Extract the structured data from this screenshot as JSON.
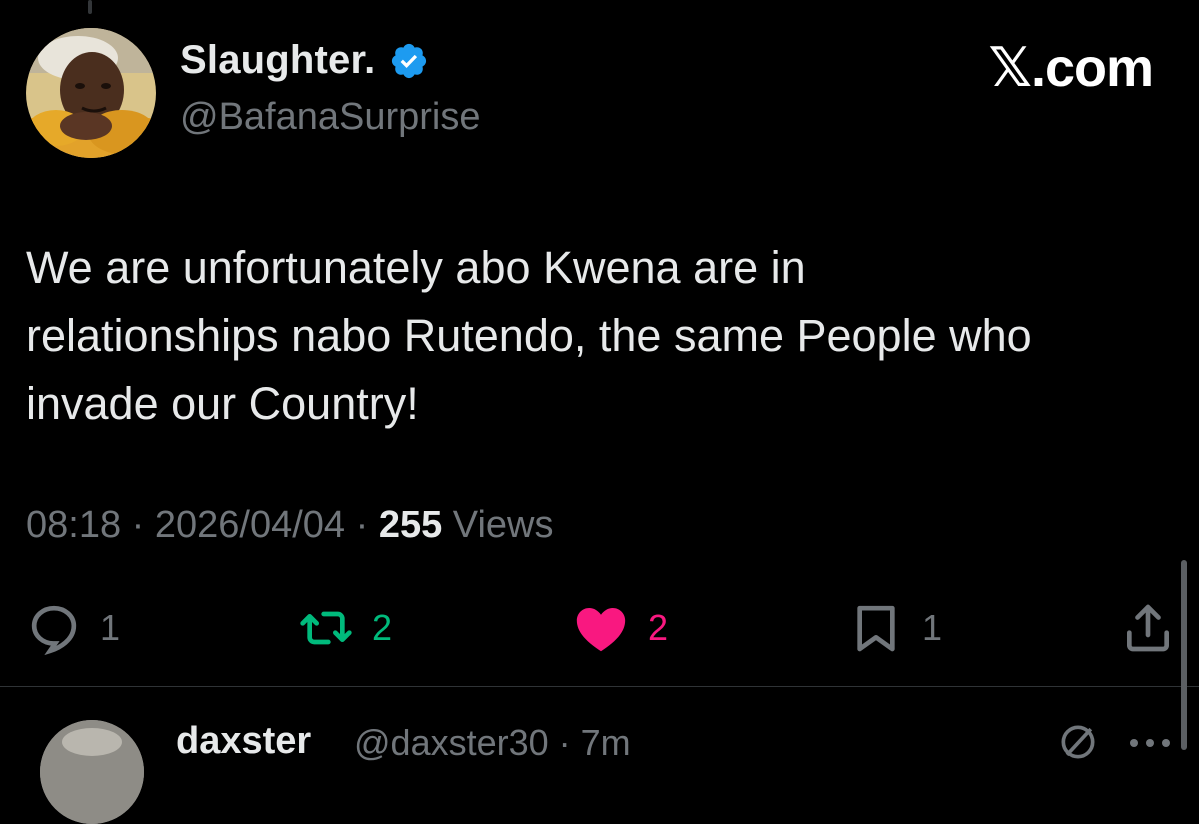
{
  "tweet": {
    "author": {
      "display_name": "Slaughter.",
      "handle": "@BafanaSurprise",
      "verified": true,
      "avatar_icon": "profile-photo"
    },
    "brand": "𝕏.com",
    "text": "We are unfortunately abo Kwena are in\nrelationships nabo Rutendo, the same People who\ninvade our Country!",
    "meta": {
      "time": "08:18",
      "separator": " · ",
      "date": "2026/04/04",
      "views_count": "255",
      "views_label": " Views"
    },
    "actions": {
      "replies": "1",
      "reposts": "2",
      "likes": "2",
      "bookmarks": "1"
    }
  },
  "reply": {
    "display_name": "daxster",
    "handle_time": "@daxster30 · 7m"
  },
  "colors": {
    "background": "#000000",
    "text_primary": "#e7e9ea",
    "text_secondary": "#71767b",
    "verified_blue": "#1d9bf0",
    "repost_green": "#00ba7c",
    "like_pink": "#f91880",
    "divider": "#2f3336"
  }
}
